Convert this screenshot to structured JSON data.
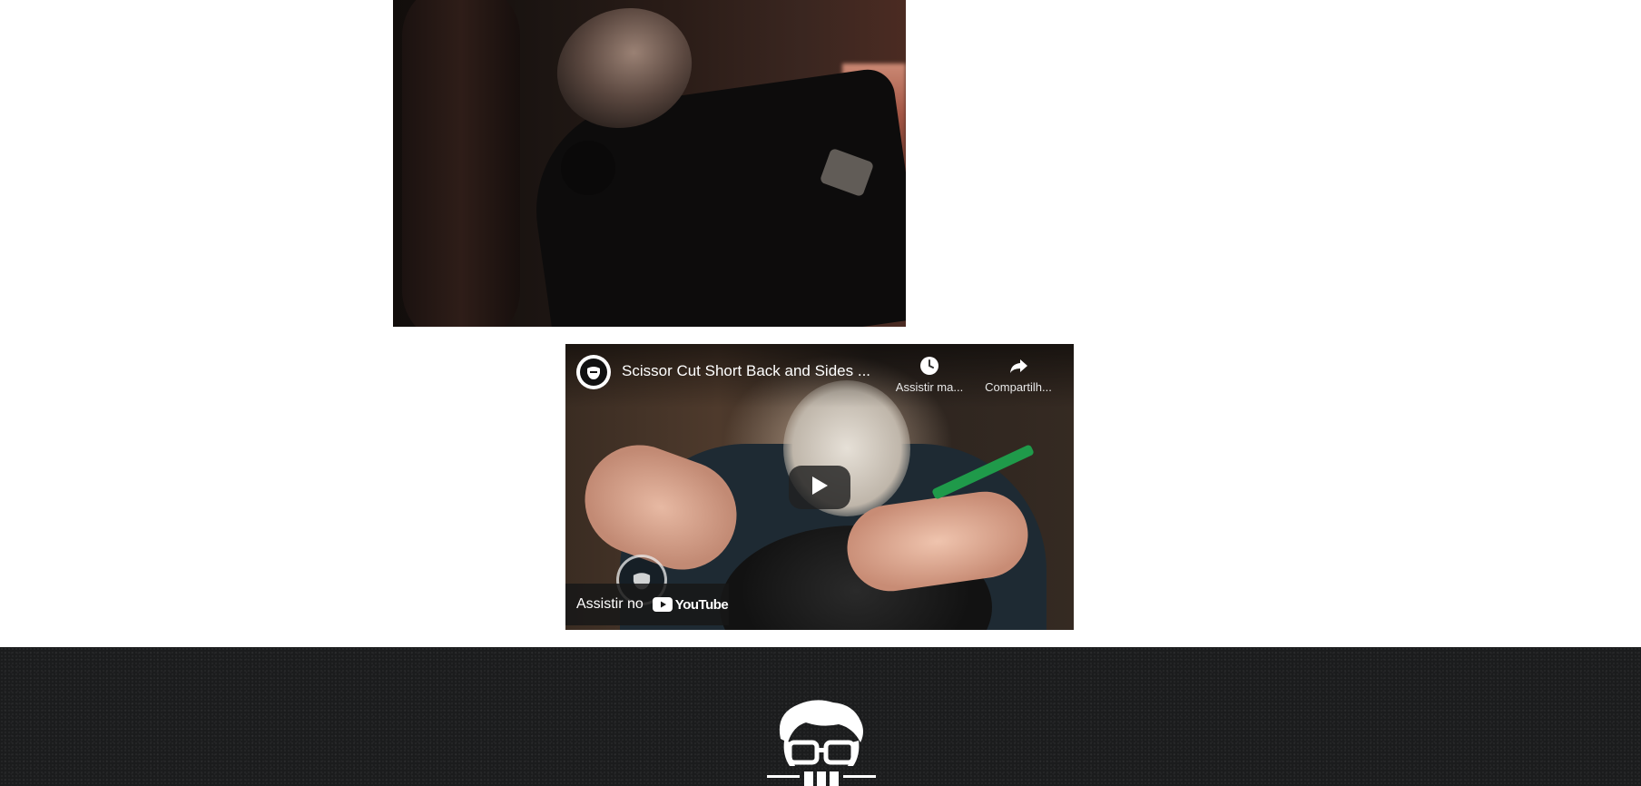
{
  "photo": {
    "alt": "Barbeiro cortando barba de cliente"
  },
  "video": {
    "title": "Scissor Cut Short Back and Sides ...",
    "watch_later_label": "Assistir ma...",
    "share_label": "Compartilh...",
    "watch_on_label": "Assistir no",
    "youtube_word": "YouTube"
  },
  "icons": {
    "channel": "beard-logo-icon",
    "watch_later": "clock-icon",
    "share": "share-arrow-icon",
    "play": "play-icon",
    "youtube": "youtube-logo-icon",
    "footer_logo": "barber-glasses-logo-icon"
  },
  "colors": {
    "footer_bg": "#1b1c1d",
    "play_bg": "#212121",
    "youtube_red": "#ff0000"
  }
}
